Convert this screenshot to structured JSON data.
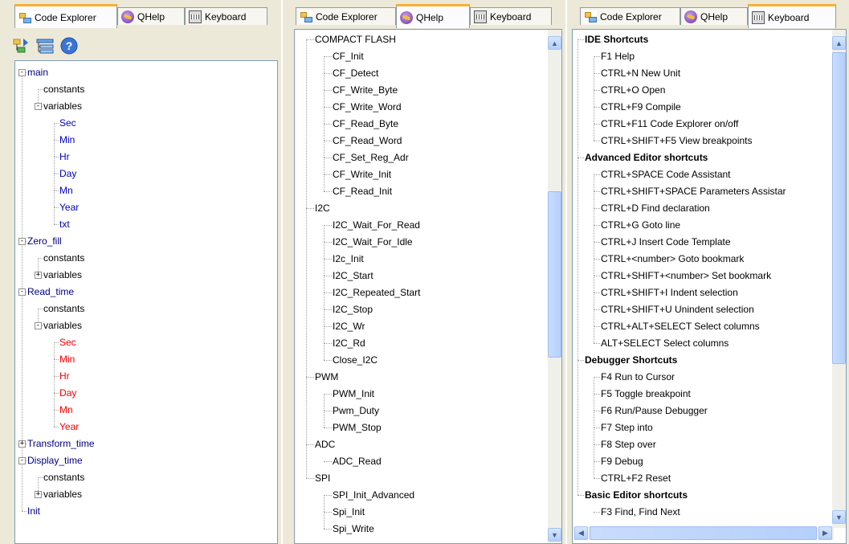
{
  "tabs": {
    "code_explorer": "Code Explorer",
    "qhelp": "QHelp",
    "keyboard": "Keyboard"
  },
  "colors": {
    "accent_tab": "#f9b233",
    "routine": "#000080",
    "var_blue": "#0000c0",
    "var_red": "#ff0000"
  },
  "panel1": {
    "toolbar": [
      {
        "icon": "export-tree-icon"
      },
      {
        "icon": "collapse-tree-icon"
      },
      {
        "icon": "help-icon"
      }
    ],
    "tree": [
      {
        "label": "main",
        "level": 0,
        "exp": "-",
        "color": "navy"
      },
      {
        "label": "constants",
        "level": 1
      },
      {
        "label": "variables",
        "level": 1,
        "exp": "-"
      },
      {
        "label": "Sec",
        "level": 2,
        "color": "blue"
      },
      {
        "label": "Min",
        "level": 2,
        "color": "blue"
      },
      {
        "label": "Hr",
        "level": 2,
        "color": "blue"
      },
      {
        "label": "Day",
        "level": 2,
        "color": "blue"
      },
      {
        "label": "Mn",
        "level": 2,
        "color": "blue"
      },
      {
        "label": "Year",
        "level": 2,
        "color": "blue"
      },
      {
        "label": "txt",
        "level": 2,
        "color": "blue"
      },
      {
        "label": "Zero_fill",
        "level": 0,
        "exp": "-",
        "color": "navy"
      },
      {
        "label": "constants",
        "level": 1
      },
      {
        "label": "variables",
        "level": 1,
        "exp": "+"
      },
      {
        "label": "Read_time",
        "level": 0,
        "exp": "-",
        "color": "navy"
      },
      {
        "label": "constants",
        "level": 1
      },
      {
        "label": "variables",
        "level": 1,
        "exp": "-"
      },
      {
        "label": "Sec",
        "level": 2,
        "color": "red"
      },
      {
        "label": "Min",
        "level": 2,
        "color": "red"
      },
      {
        "label": "Hr",
        "level": 2,
        "color": "red"
      },
      {
        "label": "Day",
        "level": 2,
        "color": "red"
      },
      {
        "label": "Mn",
        "level": 2,
        "color": "red"
      },
      {
        "label": "Year",
        "level": 2,
        "color": "red"
      },
      {
        "label": "Transform_time",
        "level": 0,
        "exp": "+",
        "color": "navy"
      },
      {
        "label": "Display_time",
        "level": 0,
        "exp": "-",
        "color": "navy"
      },
      {
        "label": "constants",
        "level": 1
      },
      {
        "label": "variables",
        "level": 1,
        "exp": "+"
      },
      {
        "label": "Init",
        "level": 0,
        "color": "navy"
      }
    ]
  },
  "panel2": {
    "tree": [
      {
        "label": "COMPACT FLASH",
        "level": 0
      },
      {
        "label": "CF_Init",
        "level": 1
      },
      {
        "label": "CF_Detect",
        "level": 1
      },
      {
        "label": "CF_Write_Byte",
        "level": 1
      },
      {
        "label": "CF_Write_Word",
        "level": 1
      },
      {
        "label": "CF_Read_Byte",
        "level": 1
      },
      {
        "label": "CF_Read_Word",
        "level": 1
      },
      {
        "label": "CF_Set_Reg_Adr",
        "level": 1
      },
      {
        "label": "CF_Write_Init",
        "level": 1
      },
      {
        "label": "CF_Read_Init",
        "level": 1
      },
      {
        "label": "I2C",
        "level": 0
      },
      {
        "label": "I2C_Wait_For_Read",
        "level": 1
      },
      {
        "label": "I2C_Wait_For_Idle",
        "level": 1
      },
      {
        "label": "I2c_Init",
        "level": 1
      },
      {
        "label": "I2C_Start",
        "level": 1
      },
      {
        "label": "I2C_Repeated_Start",
        "level": 1
      },
      {
        "label": "I2C_Stop",
        "level": 1
      },
      {
        "label": "I2C_Wr",
        "level": 1
      },
      {
        "label": "I2C_Rd",
        "level": 1
      },
      {
        "label": "Close_I2C",
        "level": 1
      },
      {
        "label": "PWM",
        "level": 0
      },
      {
        "label": "PWM_Init",
        "level": 1
      },
      {
        "label": "Pwm_Duty",
        "level": 1
      },
      {
        "label": "PWM_Stop",
        "level": 1
      },
      {
        "label": "ADC",
        "level": 0
      },
      {
        "label": "ADC_Read",
        "level": 1
      },
      {
        "label": "SPI",
        "level": 0
      },
      {
        "label": "SPI_Init_Advanced",
        "level": 1
      },
      {
        "label": "Spi_Init",
        "level": 1
      },
      {
        "label": "Spi_Write",
        "level": 1
      }
    ]
  },
  "panel3": {
    "tree": [
      {
        "label": "IDE  Shortcuts",
        "level": 0,
        "bold": true
      },
      {
        "label": "F1     Help",
        "level": 1
      },
      {
        "label": "CTRL+N  New Unit",
        "level": 1
      },
      {
        "label": "CTRL+O  Open",
        "level": 1
      },
      {
        "label": "CTRL+F9 Compile",
        "level": 1
      },
      {
        "label": "CTRL+F11 Code Explorer on/off",
        "level": 1
      },
      {
        "label": "CTRL+SHIFT+F5  View breakpoints",
        "level": 1
      },
      {
        "label": "Advanced Editor shortcuts",
        "level": 0,
        "bold": true
      },
      {
        "label": "CTRL+SPACE         Code Assistant",
        "level": 1
      },
      {
        "label": "CTRL+SHIFT+SPACE  Parameters Assistar",
        "level": 1
      },
      {
        "label": "CTRL+D  Find declaration",
        "level": 1
      },
      {
        "label": "CTRL+G  Goto line",
        "level": 1
      },
      {
        "label": "CTRL+J  Insert Code Template",
        "level": 1
      },
      {
        "label": "CTRL+<number>        Goto bookmark",
        "level": 1
      },
      {
        "label": "CTRL+SHIFT+<number>  Set bookmark",
        "level": 1
      },
      {
        "label": "CTRL+SHIFT+I  Indent selection",
        "level": 1
      },
      {
        "label": "CTRL+SHIFT+U  Unindent selection",
        "level": 1
      },
      {
        "label": "CTRL+ALT+SELECT  Select columns",
        "level": 1
      },
      {
        "label": "ALT+SELECT  Select columns",
        "level": 1
      },
      {
        "label": "Debugger Shortcuts",
        "level": 0,
        "bold": true
      },
      {
        "label": "F4  Run to Cursor",
        "level": 1
      },
      {
        "label": "F5  Toggle breakpoint",
        "level": 1
      },
      {
        "label": "F6  Run/Pause Debugger",
        "level": 1
      },
      {
        "label": "F7  Step into",
        "level": 1
      },
      {
        "label": "F8  Step over",
        "level": 1
      },
      {
        "label": "F9  Debug",
        "level": 1
      },
      {
        "label": "CTRL+F2  Reset",
        "level": 1
      },
      {
        "label": "Basic Editor shortcuts",
        "level": 0,
        "bold": true
      },
      {
        "label": "F3       Find, Find Next",
        "level": 1
      }
    ]
  }
}
